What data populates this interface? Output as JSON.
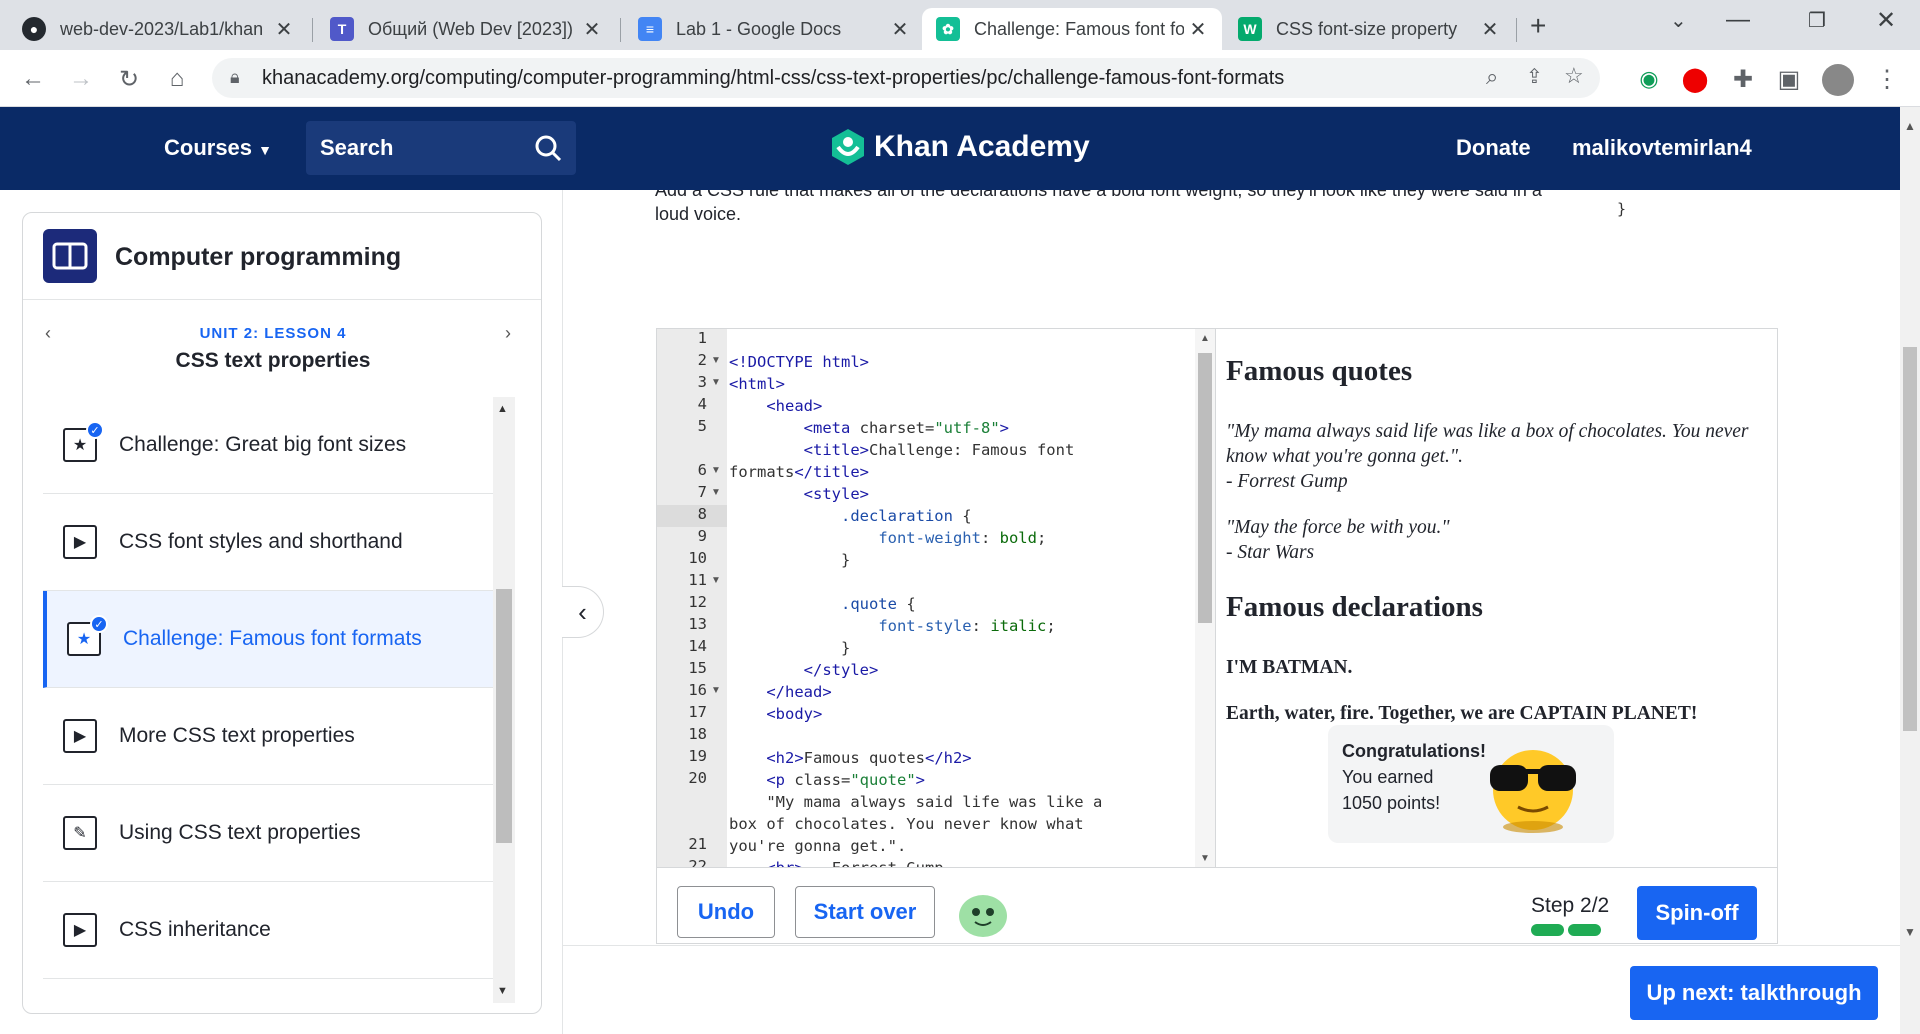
{
  "browser": {
    "tabs": [
      {
        "title": "web-dev-2023/Lab1/khan",
        "icon": "github-icon"
      },
      {
        "title": "Общий (Web Dev [2023])",
        "icon": "teams-icon"
      },
      {
        "title": "Lab 1 - Google Docs",
        "icon": "docs-icon"
      },
      {
        "title": "Challenge: Famous font fo",
        "icon": "khan-icon"
      },
      {
        "title": "CSS font-size property",
        "icon": "w3schools-icon"
      }
    ],
    "url": "khanacademy.org/computing/computer-programming/html-css/css-text-properties/pc/challenge-famous-font-formats"
  },
  "header": {
    "courses": "Courses",
    "search": "Search",
    "logo": "Khan Academy",
    "donate": "Donate",
    "user": "malikovtemirlan4"
  },
  "sidebar": {
    "course_title": "Computer programming",
    "unit": "UNIT 2: LESSON 4",
    "lesson": "CSS text properties",
    "items": [
      {
        "label": "Challenge: Great big font sizes",
        "icon": "star-icon"
      },
      {
        "label": "CSS font styles and shorthand",
        "icon": "play-icon"
      },
      {
        "label": "Challenge: Famous font formats",
        "icon": "star-icon"
      },
      {
        "label": "More CSS text properties",
        "icon": "play-icon"
      },
      {
        "label": "Using CSS text properties",
        "icon": "pencil-icon"
      },
      {
        "label": "CSS inheritance",
        "icon": "play-icon"
      }
    ]
  },
  "instructions": {
    "cut_line": "Add a CSS rule that makes all of the declarations have a bold font weight, so they'll look like they were said in a",
    "line2": "loud voice.",
    "code_fragment": "}"
  },
  "editor": {
    "line_numbers": [
      "1",
      "2",
      "3",
      "4",
      "5",
      "",
      "6",
      "7",
      "8",
      "9",
      "10",
      "11",
      "12",
      "13",
      "14",
      "15",
      "16",
      "17",
      "18",
      "19",
      "20",
      "",
      "",
      "21",
      "22"
    ]
  },
  "preview": {
    "h1": "Famous quotes",
    "q1": "\"My mama always said life was like a box of chocolates. You never know what you're gonna get.\".",
    "q1_author": "- Forrest Gump",
    "q2": "\"May the force be with you.\"",
    "q2_author": "- Star Wars",
    "h2": "Famous declarations",
    "d1": "I'M BATMAN.",
    "d2": "Earth, water, fire. Together, we are CAPTAIN PLANET!",
    "toast_title": "Congratulations!",
    "toast_line1": "You earned",
    "toast_line2": "1050 points!"
  },
  "bottom": {
    "undo": "Undo",
    "start_over": "Start over",
    "step": "Step 2/2",
    "step_fraction": 1.0,
    "spinoff": "Spin-off",
    "up_next": "Up next: talkthrough"
  }
}
